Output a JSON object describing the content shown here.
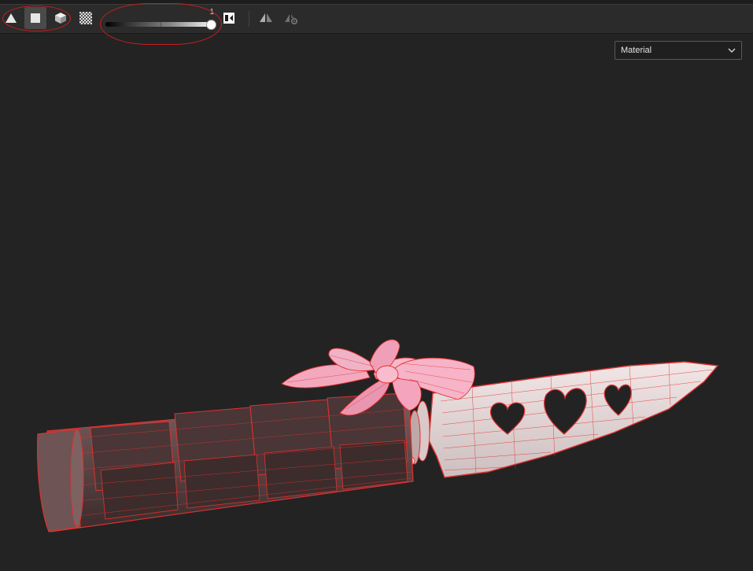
{
  "toolbar": {
    "shading_modes": [
      {
        "name": "wireframe",
        "icon": "triangle-icon",
        "active": false
      },
      {
        "name": "solid",
        "icon": "square-icon",
        "active": true
      },
      {
        "name": "shaded",
        "icon": "cube-icon",
        "active": false
      }
    ],
    "checker_icon": "checkerboard-icon",
    "opacity_slider": {
      "value": "1",
      "level": 1.0
    },
    "swap_icon": "swap-icon",
    "symmetry_icon": "symmetry-icon",
    "symmetry_settings_icon": "symmetry-settings-icon"
  },
  "viewport": {
    "display_mode": {
      "selected": "Material"
    },
    "background": "#232323",
    "model": {
      "wire_color": "#e03030",
      "handle_color": "#5a4444",
      "blade_color": "#e9dcdc",
      "bow_color": "#f4a9bf"
    }
  },
  "annotations": {
    "color": "#c81e1e"
  }
}
